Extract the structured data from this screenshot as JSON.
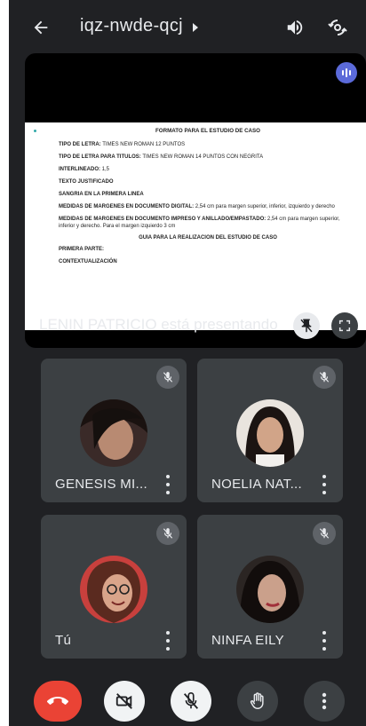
{
  "meeting": {
    "code": "iqz-nwde-qcj"
  },
  "presentation": {
    "presenter_label": "LENIN PATRICIO está presentando",
    "document": {
      "heading": "FORMATO PARA EL ESTUDIO DE CASO",
      "lines": [
        {
          "label": "TIPO DE LETRA:",
          "text": " TIMES NEW ROMAN 12 PUNTOS"
        },
        {
          "label": "TIPO DE LETRA PARA TITULOS:",
          "text": " TIMES NEW ROMAN 14 PUNTOS CON NEGRITA"
        },
        {
          "label": "INTERLINEADO:",
          "text": " 1,5"
        },
        {
          "label": "TEXTO JUSTIFICADO",
          "text": ""
        },
        {
          "label": "SANGRIA EN LA PRIMERA LINEA",
          "text": ""
        },
        {
          "label": "MEDIDAS DE MARGENES EN DOCUMENTO DIGITAL:",
          "text": " 2,54 cm para margen superior, inferior, izquierdo y derecho"
        },
        {
          "label": "MEDIDAS DE MARGENES EN DOCUMENTO IMPRESO Y ANILLADO/EMPASTADO:",
          "text": " 2,54 cm para margen superior, inferior y derecho. Para el margen izquierdo 3 cm"
        }
      ],
      "guide_heading": "GUIA PARA LA REALIZACION DEL ESTUDIO DE CASO",
      "after_lines": [
        "PRIMERA PARTE:",
        "CONTEXTUALIZACIÓN"
      ]
    }
  },
  "participants": [
    {
      "name": "GENESIS MI...",
      "muted": true
    },
    {
      "name": "NOELIA NAT...",
      "muted": true
    },
    {
      "name": "Tú",
      "muted": true
    },
    {
      "name": "NINFA EILY",
      "muted": true
    }
  ],
  "icons": {
    "back": "arrow-left-icon",
    "title_caret": "caret-right-icon",
    "speaker": "speaker-icon",
    "switch_camera": "switch-camera-icon",
    "audio": "audio-levels-icon",
    "unpin": "unpin-icon",
    "fullscreen": "fullscreen-icon",
    "mic_off": "mic-off-icon",
    "more": "more-vert-icon",
    "end_call": "end-call-icon",
    "camera_off": "camera-off-icon",
    "hand": "raise-hand-icon"
  },
  "colors": {
    "background": "#202124",
    "tile": "#3c4043",
    "end_call": "#ea4335",
    "audio_badge": "#5b6ad9",
    "text": "#e8eaed"
  }
}
